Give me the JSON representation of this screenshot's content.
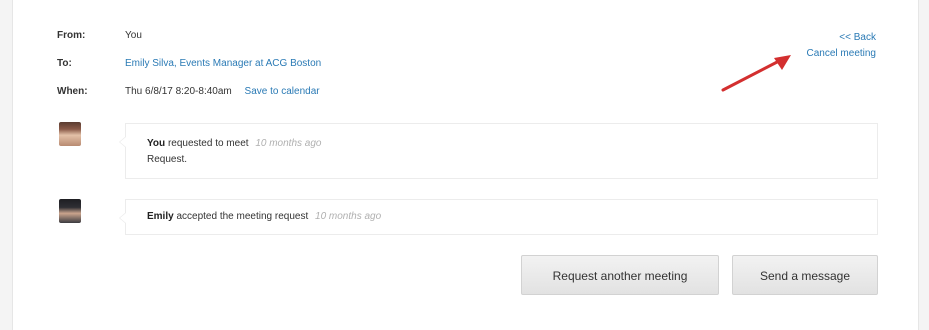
{
  "meeting": {
    "from_label": "From:",
    "from_value": "You",
    "to_label": "To:",
    "to_value": "Emily Silva, Events Manager at ACG Boston",
    "when_label": "When:",
    "when_value": "Thu 6/8/17 8:20-8:40am",
    "save_to_calendar": "Save to calendar"
  },
  "links": {
    "back": "<< Back",
    "cancel": "Cancel meeting"
  },
  "activity": [
    {
      "actor": "You",
      "action": "requested to meet",
      "time": "10 months ago",
      "message": "Request."
    },
    {
      "actor": "Emily",
      "action": "accepted the meeting request",
      "time": "10 months ago"
    }
  ],
  "buttons": {
    "request_another": "Request another meeting",
    "send_message": "Send a message"
  },
  "colors": {
    "link": "#2a7ab5",
    "annotation_arrow": "#d32f2f"
  }
}
